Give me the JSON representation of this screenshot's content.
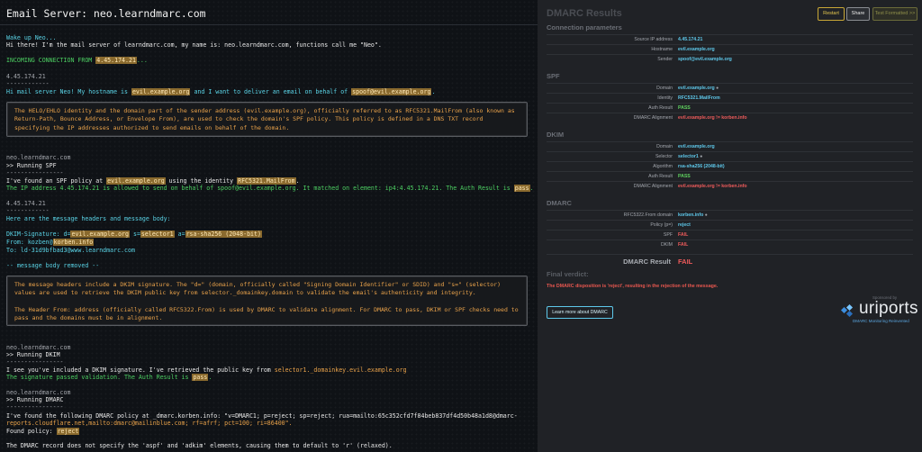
{
  "terminal": {
    "title": "Email Server: neo.learndmarc.com",
    "lines": {
      "wake": "Wake up Neo...",
      "hi": "Hi there! I'm the mail server of learndmarc.com, my name is: neo.learndmarc.com, functions call me \"Neo\".",
      "incoming_prefix": "INCOMING CONNECTION FROM ",
      "incoming_ip": "4.45.174.21",
      "incoming_suffix": "...",
      "ip_header": "4.45.174.21",
      "dashes": "------------",
      "helo_1": "Hi mail server Neo! My hostname is ",
      "helo_host": "evil.example.org",
      "helo_2": " and I want to deliver an email on behalf of ",
      "helo_from": "spoof@evil.example.org",
      "helo_3": ".",
      "neo_host": "neo.learndmarc.com",
      "running_spf": ">> Running SPF",
      "dashes_long": "----------------",
      "spf_1": "I've found an SPF policy at ",
      "spf_domain": "evil.example.org",
      "spf_2": " using the identity ",
      "spf_identity": "RFC5321.MailFrom",
      "spf_3": ".",
      "spf_pass_1": "The IP address 4.45.174.21 is allowed to send on behalf of spoof@evil.example.org. It matched on element: ip4:4.45.174.21. The Auth Result is ",
      "spf_pass_word": "pass",
      "spf_pass_2": ".",
      "headers_intro": "Here are the message headers and message body:",
      "dkim_sig_1": "DKIM-Signature: d=",
      "dkim_sig_d": "evil.example.org",
      "dkim_sig_2": " s=",
      "dkim_sig_s": "selector1",
      "dkim_sig_3": " a=",
      "dkim_sig_a": "rsa-sha256 (2048-bit)",
      "from_1": "From: kozben@",
      "from_domain": "korben.info",
      "to": "To: ld-31d9bfbad3@www.learndmarc.com",
      "body_removed": "-- message body removed --",
      "running_dkim": ">> Running DKIM",
      "dkim_1": "I see you've included a DKIM signature. I've retrieved the public key from ",
      "dkim_key": "selector1._domainkey.evil.example.org",
      "dkim_pass_1": "The signature passed validation. The Auth Result is ",
      "dkim_pass_word": "pass",
      "dkim_pass_2": ".",
      "running_dmarc": ">> Running DMARC",
      "dmarc_1": "I've found the following DMARC policy at _dmarc.korben.info: \"v=DMARC1; p=reject; sp=reject; rua=mailto:65c352cfd7f84beb837df4d50b48a1d8@dmarc-",
      "dmarc_2": "reports.cloudflare.net,mailto:dmarc@mailinblue.com; rf=afrf; pct=100; ri=86400\".",
      "found_policy": "Found policy: ",
      "found_policy_value": "reject",
      "aspf": "The DMARC record does not specify the 'aspf' and 'adkim' elements, causing them to default to 'r' (relaxed)."
    },
    "box1": "The HELO/EHLO identity and the domain part of the sender address (evil.example.org), officially referred to as RFC5321.MailFrom (also known as Return-Path, Bounce Address, or Envelope From), are used to check the domain's SPF policy. This policy is defined in a DNS TXT record specifying the IP addresses authorized to send emails on behalf of the domain.",
    "box2_p1": "The message headers include a DKIM signature. The \"d=\" (domain, officially called \"Signing Domain Identifier\" or SDID) and \"s=\" (selector) values are used to retrieve the DKIM public key from selector._domainkey.domain to validate the email's authenticity and integrity.",
    "box2_p2": "The Header From: address (officially called RFC5322.From) is used by DMARC to validate alignment. For DMARC to pass, DKIM or SPF checks need to pass and the domains must be in alignment."
  },
  "results": {
    "title": "DMARC Results",
    "buttons": {
      "restart": "Restart",
      "share": "Share",
      "format": "Test Formatted >>"
    },
    "connection": {
      "heading": "Connection parameters",
      "rows": [
        {
          "k": "Source IP address",
          "v": "4.45.174.21"
        },
        {
          "k": "Hostname",
          "v": "evil.example.org"
        },
        {
          "k": "Sender",
          "v": "spoof@evil.example.org"
        }
      ]
    },
    "spf": {
      "heading": "SPF",
      "rows": [
        {
          "k": "Domain",
          "v": "evil.example.org"
        },
        {
          "k": "Identity",
          "v": "RFC5321.MailFrom"
        },
        {
          "k": "Auth Result",
          "v": "PASS"
        },
        {
          "k": "DMARC Alignment",
          "v": "evil.example.org != korben.info"
        }
      ]
    },
    "dkim": {
      "heading": "DKIM",
      "rows": [
        {
          "k": "Domain",
          "v": "evil.example.org"
        },
        {
          "k": "Selector",
          "v": "selector1"
        },
        {
          "k": "Algorithm",
          "v": "rsa-sha256 (2048-bit)"
        },
        {
          "k": "Auth Result",
          "v": "PASS"
        },
        {
          "k": "DMARC Alignment",
          "v": "evil.example.org != korben.info"
        }
      ]
    },
    "dmarc": {
      "heading": "DMARC",
      "rows": [
        {
          "k": "RFC5322.From domain",
          "v": "korben.info"
        },
        {
          "k": "Policy (p=)",
          "v": "reject"
        },
        {
          "k": "SPF",
          "v": "FAIL"
        },
        {
          "k": "DKIM",
          "v": "FAIL"
        }
      ],
      "result_label": "DMARC Result",
      "result_value": "FAIL"
    },
    "verdict_heading": "Final verdict:",
    "verdict_text": "The DMARC disposition is 'reject', resulting in the rejection of the message.",
    "learn_button": "Learn more about DMARC",
    "sponsor": "Sponsored by",
    "logo_word": "uriports",
    "tagline": "DMARC Monitoring Reinvented",
    "colors": {
      "link": "#5ec8ea",
      "pass": "#5fd15f",
      "fail": "#ef5b5b",
      "highlight": "#8a6a2e"
    }
  }
}
